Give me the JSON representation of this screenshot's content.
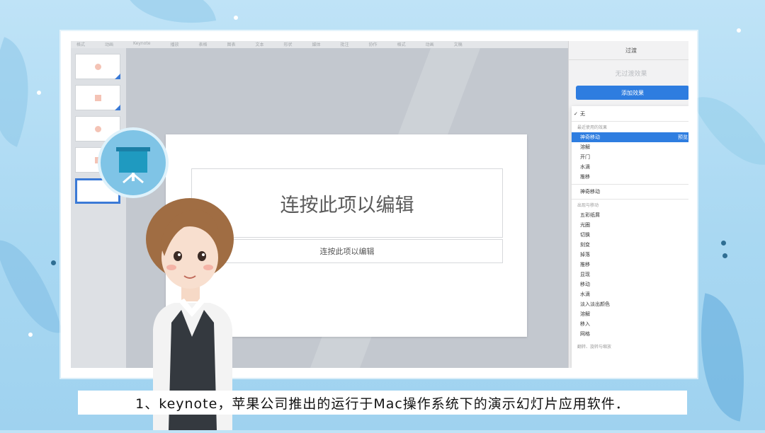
{
  "toolbar": {
    "items": [
      "格式",
      "动画",
      "Keynote",
      "播放",
      "表格",
      "图表",
      "文本",
      "形状",
      "媒体",
      "批注",
      "协作",
      "格式",
      "动画",
      "文稿"
    ]
  },
  "slide": {
    "title_placeholder": "连按此项以编辑",
    "subtitle_placeholder": "连按此项以编辑"
  },
  "panel": {
    "tab_label": "过渡",
    "no_transition_text": "无过渡效果",
    "add_effect_label": "添加效果"
  },
  "menu": {
    "none_label": "无",
    "recent_section": "最近使用的效果",
    "recent_items": [
      "神奇移动",
      "溶解",
      "开门",
      "水滴",
      "推移"
    ],
    "preview_label": "预览",
    "magic_move": "神奇移动",
    "appear_section": "出现与移动",
    "effect_items": [
      "五彩纸屑",
      "光圈",
      "切换",
      "刻变",
      "掉落",
      "推移",
      "显现",
      "移动",
      "水滴",
      "淡入淡出颜色",
      "溶解",
      "移入",
      "网格"
    ],
    "bottom_section": "翻转、旋转与缩放"
  },
  "caption": {
    "text": "1、keynote，苹果公司推出的运行于Mac操作系统下的演示幻灯片应用软件．"
  },
  "colors": {
    "accent": "#2e7de0",
    "background": "#a9d8f2",
    "badge": "#7fc4e6"
  },
  "icons": {
    "badge": "presentation-board-icon",
    "checkmark": "checkmark-icon"
  }
}
